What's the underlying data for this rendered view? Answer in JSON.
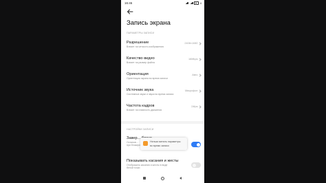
{
  "status_bar": {
    "time": "16:46",
    "battery": "4"
  },
  "header": {
    "title": "Запись экрана"
  },
  "sections": {
    "recording_params": "ПАРАМЕТРЫ ЗАПИСИ",
    "recording_settings": "НАСТРОЙКИ ЗАПИСИ"
  },
  "settings": [
    {
      "title": "Разрешение",
      "subtitle": "Влияет на четкость изображения",
      "value": "2408×1080"
    },
    {
      "title": "Качество видео",
      "subtitle": "Влияет на размер файла",
      "value": "16Mbps"
    },
    {
      "title": "Ориентация",
      "subtitle": "Ориентация экрана во время записи",
      "value": "Авто"
    },
    {
      "title": "Источник звука",
      "subtitle": "Системные звуки и звуки во время записи",
      "value": "Микрофон"
    },
    {
      "title": "Частота кадров",
      "subtitle": "Влияет на плавность движения",
      "value": "24fps"
    }
  ],
  "toggles": [
    {
      "title": "Завер... блоки...",
      "subtitle_1": "Останов...",
      "subtitle_2": "при блокировке экрана",
      "on": true
    },
    {
      "title": "Показывать касания и жесты",
      "subtitle_1": "Отображать касания и жесты в виде",
      "subtitle_2": "белой точки",
      "on": false
    }
  ],
  "toast": {
    "line1": "Нельзя менять параметры",
    "line2": "во время записи"
  },
  "icons": {
    "back": "arrow-left-icon",
    "chevron": "chevron-right-icon",
    "toast": "screen-recorder-icon",
    "nav_recents": "square-icon",
    "nav_home": "circle-icon",
    "nav_back": "triangle-left-icon"
  },
  "colors": {
    "accent": "#2e7cf6",
    "toast_icon": "#f39a2b"
  }
}
